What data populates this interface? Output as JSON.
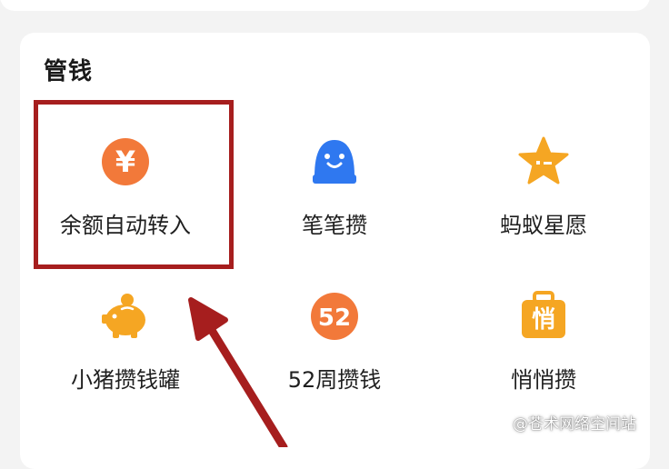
{
  "section": {
    "title": "管钱"
  },
  "tiles": [
    {
      "label": "余额自动转入",
      "icon": "yuan-coin-icon"
    },
    {
      "label": "笔笔攒",
      "icon": "smiley-piggy-icon"
    },
    {
      "label": "蚂蚁星愿",
      "icon": "star-icon"
    },
    {
      "label": "小猪攒钱罐",
      "icon": "piggy-bank-icon"
    },
    {
      "label": "52周攒钱",
      "icon": "week52-badge-icon"
    },
    {
      "label": "悄悄攒",
      "icon": "briefcase-icon"
    }
  ],
  "icon_text": {
    "yuan": "¥",
    "week": "52",
    "secret": "悄"
  },
  "watermark": "@苍术网络空间站",
  "colors": {
    "orange": "#f2793a",
    "blue": "#2f78f0",
    "gold": "#f5a623",
    "highlight": "#a61e1e"
  }
}
